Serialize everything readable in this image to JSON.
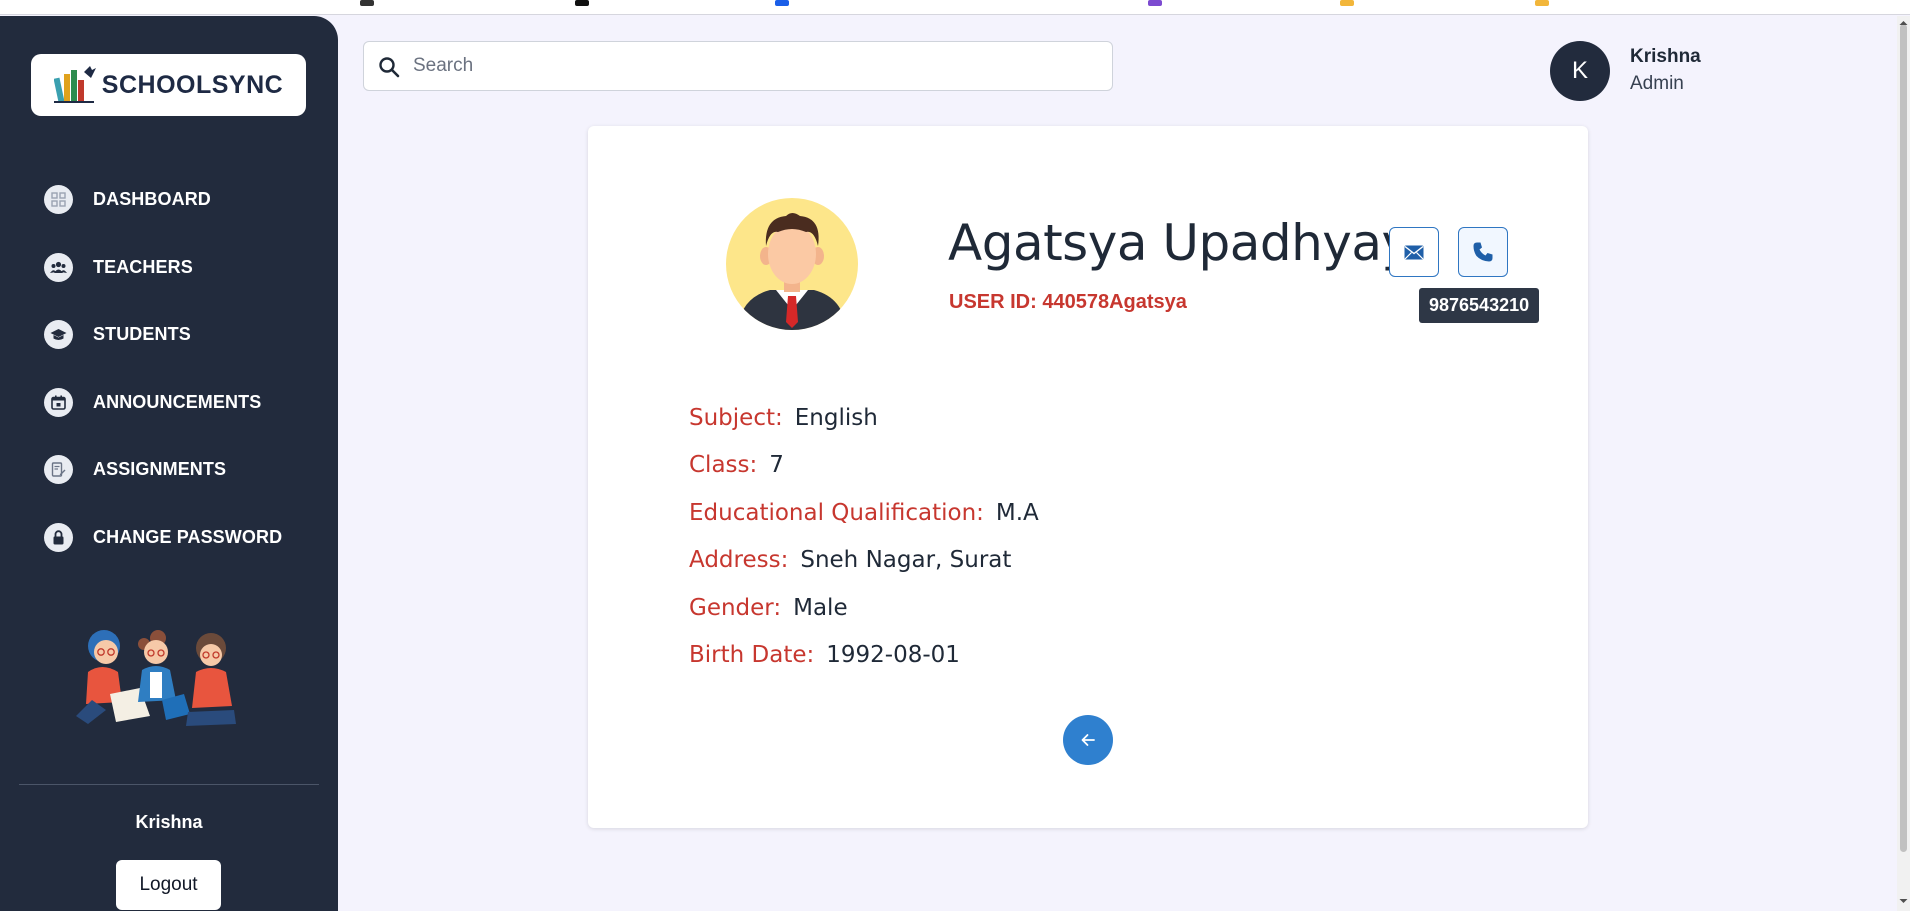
{
  "app": {
    "logo_text": "SCHOOLSYNC"
  },
  "sidebar": {
    "items": [
      {
        "label": "DASHBOARD",
        "icon": "dashboard-icon"
      },
      {
        "label": "TEACHERS",
        "icon": "users-icon"
      },
      {
        "label": "STUDENTS",
        "icon": "graduation-cap-icon"
      },
      {
        "label": "ANNOUNCEMENTS",
        "icon": "calendar-icon"
      },
      {
        "label": "ASSIGNMENTS",
        "icon": "edit-document-icon"
      },
      {
        "label": "CHANGE PASSWORD",
        "icon": "lock-icon"
      }
    ],
    "user_name": "Krishna",
    "logout_label": "Logout"
  },
  "header": {
    "search_placeholder": "Search",
    "avatar_initial": "K",
    "user_name": "Krishna",
    "user_role": "Admin"
  },
  "profile": {
    "name": "Agatsya Upadhyay",
    "user_id": "USER ID: 440578Agatsya",
    "phone_tooltip": "9876543210",
    "details": [
      {
        "label": "Subject:",
        "value": "English"
      },
      {
        "label": "Class:",
        "value": "7"
      },
      {
        "label": "Educational Qualification:",
        "value": "M.A"
      },
      {
        "label": "Address:",
        "value": "Sneh Nagar, Surat"
      },
      {
        "label": "Gender:",
        "value": "Male"
      },
      {
        "label": "Birth Date:",
        "value": "1992-08-01"
      }
    ]
  },
  "colors": {
    "sidebar_bg": "#222b3d",
    "page_bg": "#f4f3fd",
    "accent_blue": "#2f80cf",
    "label_red": "#c7372f"
  }
}
